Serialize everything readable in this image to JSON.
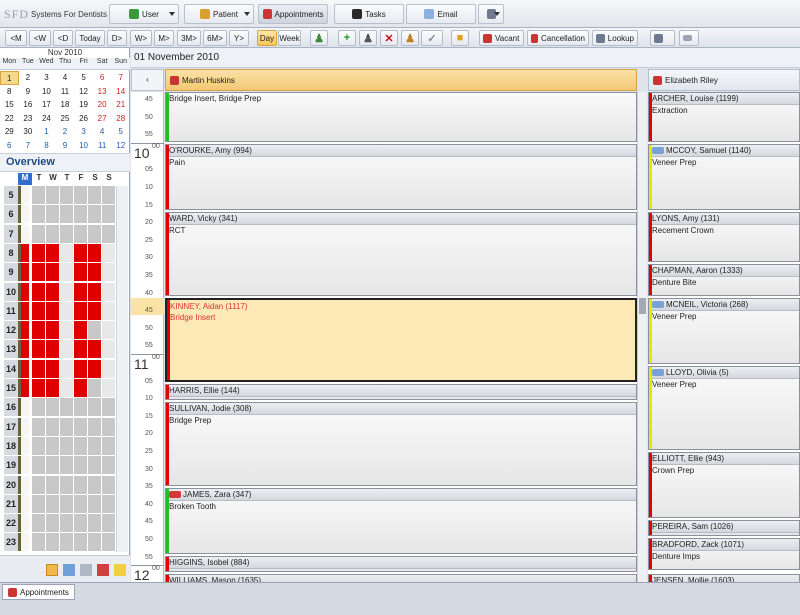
{
  "app": {
    "logo": "SFD",
    "name": "Systems For Dentists"
  },
  "menu": {
    "user": "User",
    "patient": "Patient",
    "appointments": "Appointments",
    "tasks": "Tasks",
    "email": "Email"
  },
  "nav": {
    "m_back": "<M",
    "w_back": "<W",
    "d_back": "<D",
    "today": "Today",
    "d_fwd": "D>",
    "w_fwd": "W>",
    "m_fwd": "M>",
    "m3": "3M>",
    "m6": "6M>",
    "y": "Y>",
    "day": "Day",
    "week": "Week"
  },
  "toolbar": {
    "vacant": "Vacant",
    "cancellation": "Cancellation",
    "lookup": "Lookup"
  },
  "calendar": {
    "month": "Nov 2010",
    "days": [
      "Mon",
      "Tue",
      "Wed",
      "Thu",
      "Fri",
      "Sat",
      "Sun"
    ],
    "weeks": [
      [
        "1",
        "2",
        "3",
        "4",
        "5",
        "6",
        "7"
      ],
      [
        "8",
        "9",
        "10",
        "11",
        "12",
        "13",
        "14"
      ],
      [
        "15",
        "16",
        "17",
        "18",
        "19",
        "20",
        "21"
      ],
      [
        "22",
        "23",
        "24",
        "25",
        "26",
        "27",
        "28"
      ],
      [
        "29",
        "30",
        "1",
        "2",
        "3",
        "4",
        "5"
      ],
      [
        "6",
        "7",
        "8",
        "9",
        "10",
        "11",
        "12"
      ]
    ]
  },
  "overview": {
    "title": "Overview",
    "days": [
      "M",
      "T",
      "W",
      "T",
      "F",
      "S",
      "S"
    ],
    "hours": [
      "5",
      "6",
      "7",
      "8",
      "9",
      "10",
      "11",
      "12",
      "13",
      "14",
      "15",
      "16",
      "17",
      "18",
      "19",
      "20",
      "21",
      "22",
      "23"
    ]
  },
  "main": {
    "date": "01 November 2010"
  },
  "columns": [
    {
      "name": "Martin Huskins"
    },
    {
      "name": "Elizabeth Riley"
    }
  ],
  "times": {
    "hours": [
      "10",
      "11",
      "12"
    ],
    "minute_labels": [
      "45",
      "50",
      "55",
      "00",
      "05",
      "10",
      "15",
      "20",
      "25",
      "30",
      "35",
      "40",
      "45",
      "50",
      "55",
      "00",
      "05",
      "10",
      "15",
      "20",
      "25",
      "30",
      "35",
      "40",
      "45",
      "50",
      "55",
      "00",
      "05"
    ]
  },
  "appointments_col1": [
    {
      "patient": "",
      "treatment": "Bridge Insert, Bridge Prep"
    },
    {
      "patient": "O'ROURKE, Amy (994)",
      "treatment": "Pain"
    },
    {
      "patient": "WARD, Vicky (341)",
      "treatment": "RCT"
    },
    {
      "patient": "KINNEY, Aidan (1117)",
      "treatment": "Bridge Insert"
    },
    {
      "patient": "HARRIS, Ellie (144)",
      "treatment": ""
    },
    {
      "patient": "SULLIVAN, Jodie (308)",
      "treatment": "Bridge Prep"
    },
    {
      "patient": "JAMES, Zara (347)",
      "treatment": "Broken Tooth"
    },
    {
      "patient": "HIGGINS, Isobel (884)",
      "treatment": ""
    },
    {
      "patient": "WILLIAMS, Mason (1635)",
      "treatment": ""
    }
  ],
  "appointments_col2": [
    {
      "patient": "ARCHER, Louise (1199)",
      "treatment": "Extraction"
    },
    {
      "patient": "MCCOY, Samuel (1140)",
      "treatment": "Veneer Prep"
    },
    {
      "patient": "LYONS, Amy (131)",
      "treatment": "Recement Crown"
    },
    {
      "patient": "CHAPMAN, Aaron (1333)",
      "treatment": "Denture Bite"
    },
    {
      "patient": "MCNEIL, Victoria (268)",
      "treatment": "Veneer Prep"
    },
    {
      "patient": "LLOYD, Olivia (5)",
      "treatment": "Veneer Prep"
    },
    {
      "patient": "ELLIOTT, Ellie (943)",
      "treatment": "Crown Prep"
    },
    {
      "patient": "PEREIRA, Sam (1026)",
      "treatment": ""
    },
    {
      "patient": "BRADFORD, Zack (1071)",
      "treatment": "Denture Imps"
    },
    {
      "patient": "JENSEN, Mollie (1603)",
      "treatment": ""
    }
  ],
  "status_tab": "Appointments",
  "colors": {
    "accent": "#f3c874",
    "red": "#e00000",
    "green": "#22c022",
    "yellow": "#e6e600"
  }
}
